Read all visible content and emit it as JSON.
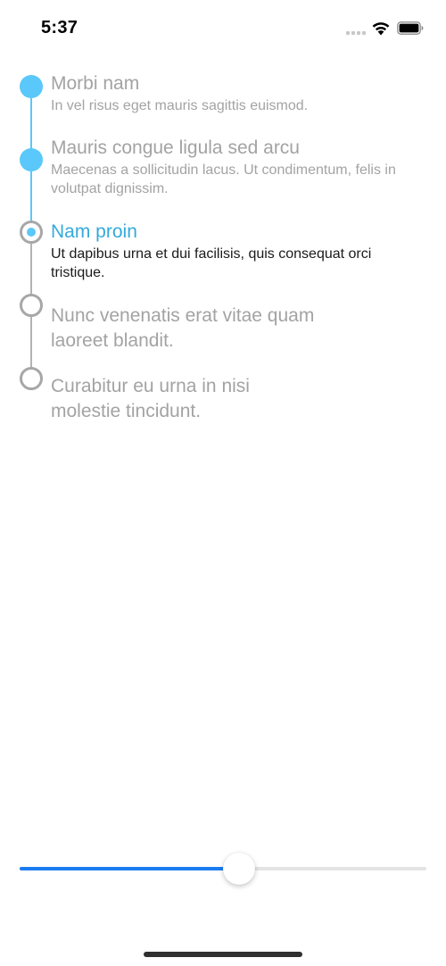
{
  "status_bar": {
    "time": "5:37",
    "icons": [
      "signal-dots-icon",
      "wifi-icon",
      "battery-icon"
    ]
  },
  "timeline": {
    "steps": [
      {
        "title": "Morbi nam",
        "description": "In vel risus eget mauris sagittis euismod.",
        "state": "completed"
      },
      {
        "title": "Mauris congue ligula sed arcu",
        "description": "Maecenas a sollicitudin lacus. Ut condimentum, felis in volutpat dignissim.",
        "state": "completed"
      },
      {
        "title": "Nam proin",
        "description": "Ut dapibus urna et dui facilisis, quis consequat orci tristique.",
        "state": "current"
      },
      {
        "title": "Nunc venenatis erat vitae quam laoreet blandit.",
        "description": "",
        "state": "pending"
      },
      {
        "title": "Curabitur eu urna in nisi molestie tincidunt.",
        "description": "",
        "state": "pending"
      }
    ]
  },
  "slider": {
    "value": 0.54
  },
  "colors": {
    "completed": "#5ac8fa",
    "current_title": "#34aadc",
    "pending": "#a7a7a7",
    "slider_fill": "#1b7cf0",
    "slider_track": "#e4e4e4"
  }
}
